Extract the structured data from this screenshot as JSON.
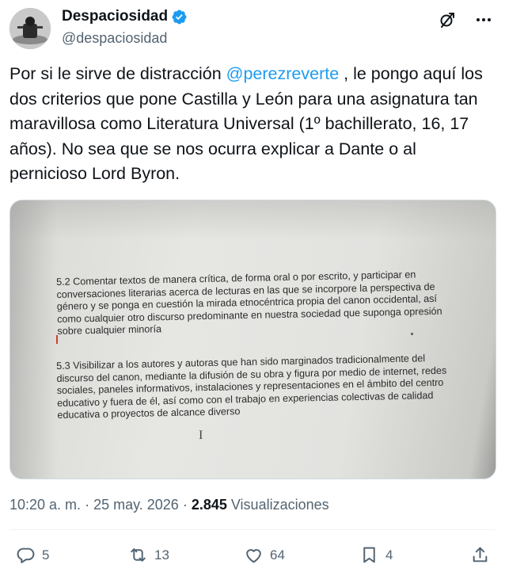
{
  "tweet": {
    "author": {
      "display_name": "Despaciosidad",
      "handle": "@despaciosidad",
      "verified": true,
      "avatar_icon": "avatar-image"
    },
    "header_icons": [
      "grok-icon",
      "more-icon"
    ],
    "text": {
      "before_mention": "Por si le sirve de distracción ",
      "mention": "@perezreverte",
      "after_mention": " , le pongo aquí los dos criterios que pone Castilla y León para una asignatura tan maravillosa como Literatura Universal (1º bachillerato, 16, 17 años). No sea que se nos ocurra explicar a Dante o al pernicioso Lord Byron."
    },
    "media": {
      "paragraph_1": "5.2 Comentar textos de manera crítica, de forma oral o por escrito, y participar en conversaciones literarias acerca de lecturas en las que se incorpore la perspectiva de género y se ponga en cuestión la mirada etnocéntrica propia del canon occidental, así como cualquier otro discurso predominante en nuestra sociedad que suponga opresión sobre cualquier minoría",
      "paragraph_2": "5.3 Visibilizar a los autores y autoras que han sido marginados tradicionalmente del discurso del canon, mediante la difusión de su obra y figura por medio de internet, redes sociales, paneles informativos, instalaciones y representaciones en el ámbito del centro educativo y fuera de él, así como con el trabajo en experiencias colectivas de calidad educativa o proyectos de alcance diverso",
      "cursor_glyph": "I"
    },
    "meta": {
      "time": "10:20 a. m.",
      "separator": " · ",
      "date": "25 may. 2026",
      "views_count": "2.845",
      "views_label": "Visualizaciones"
    },
    "actions": {
      "replies": "5",
      "reposts": "13",
      "likes": "64",
      "bookmarks": "4"
    },
    "colors": {
      "accent": "#1d9bf0",
      "text": "#0f1419",
      "secondary": "#536471"
    }
  }
}
